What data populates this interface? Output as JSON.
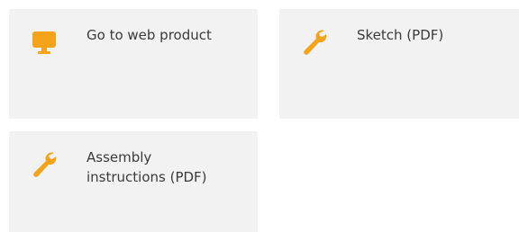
{
  "accent_color": "#f5a31a",
  "cards": [
    {
      "icon": "monitor-icon",
      "label": "Go to web product"
    },
    {
      "icon": "wrench-icon",
      "label": "Sketch (PDF)"
    },
    {
      "icon": "wrench-icon",
      "label": "Assembly instructions (PDF)"
    }
  ]
}
